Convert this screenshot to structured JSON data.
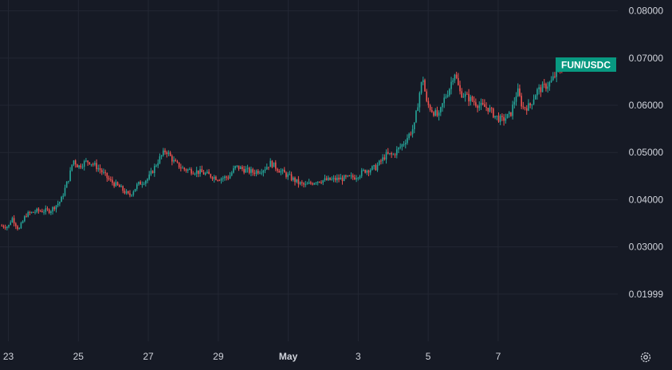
{
  "colors": {
    "background": "#161a25",
    "grid": "#232733",
    "text": "#d1d4dc",
    "up": "#26a69a",
    "down": "#ef5350",
    "tag": "#089981"
  },
  "symbol_tag": "FUN/USDC",
  "settings_icon": "gear-icon",
  "chart_data": {
    "type": "candlestick",
    "pair": "FUN/USDC",
    "grid": true,
    "y_axis": {
      "position": "right",
      "ticks": [
        "0.08000",
        "0.07000",
        "0.06000",
        "0.05000",
        "0.04000",
        "0.03000",
        "0.01999"
      ],
      "tick_values": [
        0.08,
        0.07,
        0.06,
        0.05,
        0.04,
        0.03,
        0.01999
      ],
      "range": [
        0.01,
        0.0823
      ]
    },
    "x_axis": {
      "ticks": [
        {
          "label": "23",
          "day": 0
        },
        {
          "label": "25",
          "day": 2
        },
        {
          "label": "27",
          "day": 4
        },
        {
          "label": "29",
          "day": 6
        },
        {
          "label": "May",
          "day": 8
        },
        {
          "label": "3",
          "day": 10
        },
        {
          "label": "5",
          "day": 12
        },
        {
          "label": "7",
          "day": 14
        }
      ],
      "range": [
        -0.24,
        17.42
      ]
    },
    "price_path": [
      [
        -0.24,
        0.0345
      ],
      [
        0.0,
        0.0343
      ],
      [
        0.1,
        0.0362
      ],
      [
        0.3,
        0.0336
      ],
      [
        0.5,
        0.0368
      ],
      [
        0.8,
        0.0376
      ],
      [
        1.2,
        0.0377
      ],
      [
        1.5,
        0.0398
      ],
      [
        1.75,
        0.0452
      ],
      [
        1.85,
        0.0485
      ],
      [
        2.0,
        0.047
      ],
      [
        2.15,
        0.0478
      ],
      [
        2.3,
        0.0482
      ],
      [
        2.6,
        0.0465
      ],
      [
        2.9,
        0.044
      ],
      [
        3.2,
        0.0425
      ],
      [
        3.45,
        0.0408
      ],
      [
        3.7,
        0.0432
      ],
      [
        4.0,
        0.0445
      ],
      [
        4.3,
        0.0485
      ],
      [
        4.5,
        0.0505
      ],
      [
        4.75,
        0.0478
      ],
      [
        5.0,
        0.0465
      ],
      [
        5.5,
        0.0458
      ],
      [
        6.0,
        0.0445
      ],
      [
        6.3,
        0.0448
      ],
      [
        6.5,
        0.047
      ],
      [
        6.8,
        0.0462
      ],
      [
        7.0,
        0.0458
      ],
      [
        7.3,
        0.0465
      ],
      [
        7.5,
        0.0478
      ],
      [
        7.75,
        0.0462
      ],
      [
        8.0,
        0.045
      ],
      [
        8.3,
        0.0435
      ],
      [
        8.5,
        0.043
      ],
      [
        8.8,
        0.044
      ],
      [
        9.2,
        0.0442
      ],
      [
        9.6,
        0.0445
      ],
      [
        9.9,
        0.0448
      ],
      [
        10.2,
        0.0462
      ],
      [
        10.5,
        0.0468
      ],
      [
        10.8,
        0.0495
      ],
      [
        11.0,
        0.0495
      ],
      [
        11.3,
        0.052
      ],
      [
        11.6,
        0.0555
      ],
      [
        11.75,
        0.0625
      ],
      [
        11.85,
        0.066
      ],
      [
        11.95,
        0.0605
      ],
      [
        12.1,
        0.059
      ],
      [
        12.3,
        0.0575
      ],
      [
        12.45,
        0.0612
      ],
      [
        12.6,
        0.0635
      ],
      [
        12.75,
        0.0672
      ],
      [
        12.9,
        0.0628
      ],
      [
        13.1,
        0.0618
      ],
      [
        13.3,
        0.0608
      ],
      [
        13.5,
        0.0598
      ],
      [
        13.7,
        0.0595
      ],
      [
        13.9,
        0.0578
      ],
      [
        14.1,
        0.0568
      ],
      [
        14.35,
        0.058
      ],
      [
        14.55,
        0.0632
      ],
      [
        14.7,
        0.0595
      ],
      [
        14.9,
        0.0598
      ],
      [
        15.1,
        0.063
      ],
      [
        15.3,
        0.0638
      ],
      [
        15.5,
        0.0648
      ],
      [
        15.7,
        0.0672
      ],
      [
        15.82,
        0.0678
      ]
    ],
    "last_price": 0.0678
  }
}
